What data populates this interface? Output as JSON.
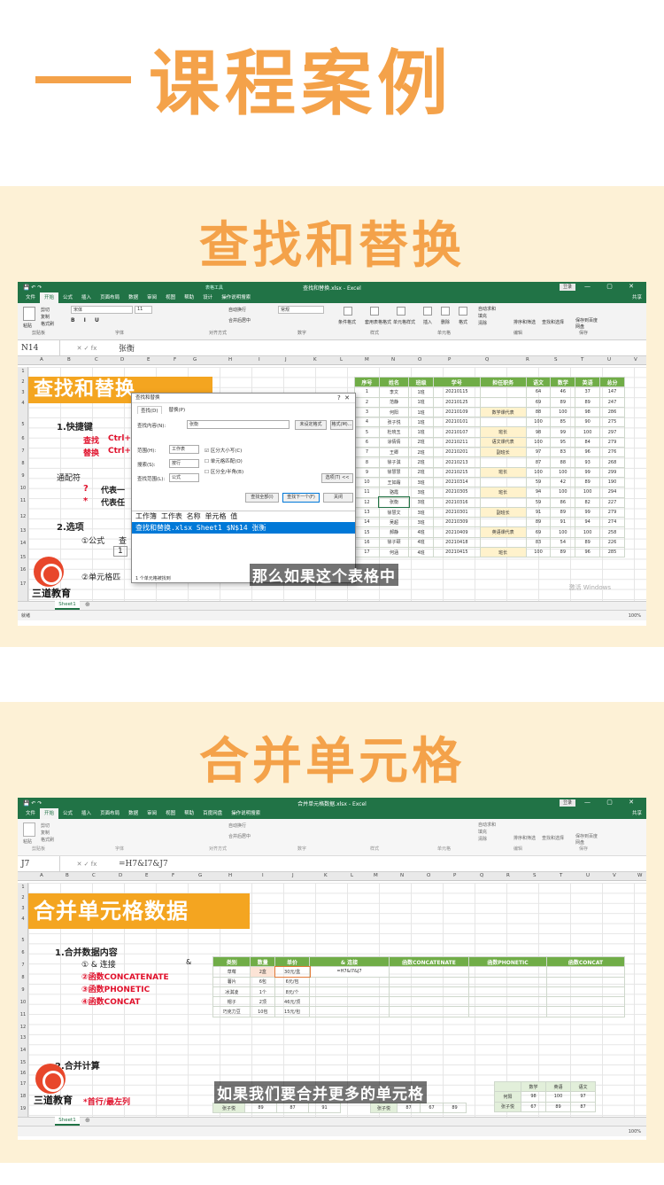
{
  "header": {
    "title": "课程案例"
  },
  "section1": {
    "title": "查找和替换",
    "excel": {
      "doc_title": "查找和替换.xlsx - Excel",
      "context_tab": "表格工具",
      "login": "登录",
      "share": "共享",
      "tabs": [
        "文件",
        "开始",
        "公式",
        "插入",
        "页面布局",
        "数据",
        "审阅",
        "视图",
        "帮助",
        "设计",
        "操作说明搜索"
      ],
      "ribbon_groups": [
        "剪贴板",
        "字体",
        "对齐方式",
        "数字",
        "样式",
        "单元格",
        "编辑",
        "保存"
      ],
      "ribbon_items": {
        "font": "宋体",
        "size": "11",
        "wrap": "自动换行",
        "merge": "合并后居中",
        "numfmt": "常规",
        "cond": "条件格式",
        "table": "套用表格格式",
        "cellstyle": "单元格样式",
        "insert": "插入",
        "delete": "删除",
        "format": "格式",
        "sum": "自动求和",
        "fill": "填充",
        "clear": "清除",
        "sort": "排序和筛选",
        "find": "查找和选择",
        "save": "保存到百度网盘",
        "paste": "粘贴",
        "cut": "剪切",
        "copy": "复制",
        "painter": "格式刷"
      },
      "namebox": "N14",
      "formula": "张衡",
      "sheet_title": "查找和替换",
      "labels": {
        "shortcut": "1.快捷键",
        "find_l": "查找",
        "find_k": "Ctrl+",
        "replace_l": "替换",
        "replace_k": "Ctrl+",
        "wildcard": "通配符",
        "q": "?",
        "q_desc": "代表一",
        "star": "*",
        "star_desc": "代表任",
        "options": "2.选项",
        "formula_opt": "①公式",
        "formula_opt2": "查",
        "num1": "1",
        "cell_match": "②单元格匹"
      },
      "table_headers": [
        "序号",
        "姓名",
        "班级",
        "学号",
        "担任职务",
        "语文",
        "数学",
        "英语",
        "总分"
      ],
      "table_rows": [
        [
          "1",
          "李文",
          "1班",
          "20210115",
          "",
          "64",
          "46",
          "37",
          "147"
        ],
        [
          "2",
          "范静",
          "1班",
          "20210125",
          "",
          "69",
          "89",
          "89",
          "247"
        ],
        [
          "3",
          "何阳",
          "1班",
          "20210109",
          "数学课代表",
          "88",
          "100",
          "98",
          "286"
        ],
        [
          "4",
          "张子悦",
          "1班",
          "20210101",
          "",
          "100",
          "85",
          "90",
          "275"
        ],
        [
          "5",
          "杜晓玉",
          "1班",
          "20210107",
          "班长",
          "98",
          "99",
          "100",
          "297"
        ],
        [
          "6",
          "涂倩倩",
          "2班",
          "20210211",
          "语文课代表",
          "100",
          "95",
          "84",
          "279"
        ],
        [
          "7",
          "王卿",
          "2班",
          "20210201",
          "副班长",
          "97",
          "83",
          "96",
          "276"
        ],
        [
          "8",
          "徐子淇",
          "2班",
          "20210213",
          "",
          "87",
          "88",
          "93",
          "268"
        ],
        [
          "9",
          "徐慧慧",
          "2班",
          "20210215",
          "班长",
          "100",
          "100",
          "99",
          "299"
        ],
        [
          "10",
          "王如霜",
          "3班",
          "20210314",
          "",
          "59",
          "42",
          "89",
          "190"
        ],
        [
          "11",
          "骆霞",
          "3班",
          "20210305",
          "班长",
          "94",
          "100",
          "100",
          "294"
        ],
        [
          "12",
          "张衡",
          "3班",
          "20210316",
          "",
          "59",
          "86",
          "82",
          "227"
        ],
        [
          "13",
          "徐慧文",
          "3班",
          "20210301",
          "副班长",
          "91",
          "89",
          "99",
          "279"
        ],
        [
          "14",
          "吴超",
          "3班",
          "20210309",
          "",
          "89",
          "91",
          "94",
          "274"
        ],
        [
          "15",
          "郝静",
          "4班",
          "20210409",
          "英语课代表",
          "69",
          "100",
          "100",
          "258"
        ],
        [
          "16",
          "徐子颐",
          "4班",
          "20210418",
          "",
          "83",
          "54",
          "89",
          "226"
        ],
        [
          "17",
          "何涵",
          "4班",
          "20210415",
          "班长",
          "100",
          "89",
          "96",
          "285"
        ]
      ],
      "dialog": {
        "title": "查找和替换",
        "tab_find": "查找(D)",
        "tab_replace": "替换(P)",
        "find_what": "查找内容(N):",
        "find_value": "张衡",
        "no_format": "未设定格式",
        "format_btn": "格式(M)...",
        "within": "范围(H):",
        "within_v": "工作表",
        "search": "搜索(S):",
        "search_v": "按行",
        "lookin": "查找范围(L):",
        "lookin_v": "公式",
        "opt1": "区分大小写(C)",
        "opt2": "单元格匹配(O)",
        "opt3": "区分全/半角(B)",
        "options_btn": "选项(T) <<",
        "find_all": "查找全部(I)",
        "find_next": "查找下一个(F)",
        "close": "关闭",
        "result_header": "工作簿          工作表 名称 单元格 值",
        "result_row": "查找和替换.xlsx Sheet1        $N$14   张衡",
        "status": "1 个单元格被找到"
      },
      "subtitle": "那么如果这个表格中",
      "sheet_tab": "Sheet1",
      "status": "就绪",
      "zoom": "100%",
      "watermark": "激活 Windows"
    }
  },
  "section2": {
    "title": "合并单元格",
    "excel": {
      "doc_title": "合并单元格数据.xlsx - Excel",
      "login": "登录",
      "share": "共享",
      "tabs": [
        "文件",
        "开始",
        "公式",
        "插入",
        "页面布局",
        "数据",
        "审阅",
        "视图",
        "帮助",
        "百度网盘",
        "操作说明搜索"
      ],
      "namebox": "J7",
      "formula": "=H7&I7&J7",
      "sheet_title": "合并单元格数据",
      "labels": {
        "merge_content": "1.合并数据内容",
        "c1": "① & 连接",
        "c1amp": "&",
        "c2": "②函数CONCATENATE",
        "c3": "③函数PHONETIC",
        "c4": "④函数CONCAT",
        "calc": "2.合并计算",
        "first_row": "*首行/最左列"
      },
      "table_headers": [
        "类别",
        "数量",
        "单价",
        "& 连接",
        "函数CONCATENATE",
        "函数PHONETIC",
        "函数CONCAT"
      ],
      "table_rows": [
        [
          "草莓",
          "2盒",
          "30元/盒",
          "=H7&I7&J7",
          "",
          "",
          ""
        ],
        [
          "薯片",
          "6包",
          "6元/包",
          "",
          "",
          "",
          ""
        ],
        [
          "冰淇凌",
          "1个",
          "8元/个",
          "",
          "",
          "",
          ""
        ],
        [
          "帽子",
          "2顶",
          "46元/顶",
          "",
          "",
          "",
          ""
        ],
        [
          "巧克力豆",
          "10包",
          "15元/包",
          "",
          "",
          "",
          ""
        ]
      ],
      "lower_left": [
        "张子悦",
        "89",
        "87",
        "91"
      ],
      "lower_mid": [
        "张子悦",
        "87",
        "67",
        "89"
      ],
      "right_headers": [
        "",
        "数学",
        "英语",
        "语文"
      ],
      "right_rows": [
        [
          "何阳",
          "98",
          "100",
          "97"
        ],
        [
          "张子悦",
          "67",
          "89",
          "87"
        ]
      ],
      "subtitle": "如果我们要合并更多的单元格",
      "sheet_tab": "Sheet1",
      "zoom": "100%"
    }
  },
  "brand": {
    "name": "三道教育",
    "accent": "#f4a24a",
    "excel_green": "#217346",
    "table_green": "#70ad47"
  }
}
